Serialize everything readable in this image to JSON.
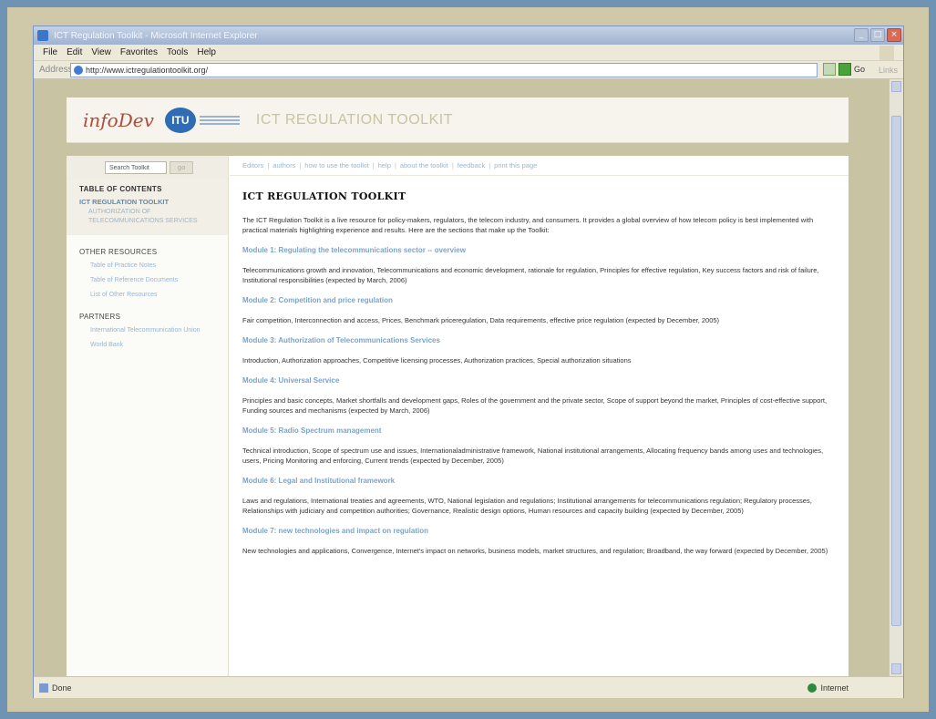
{
  "browser": {
    "window_title": "ICT Regulation Toolkit - Microsoft Internet Explorer",
    "menu": [
      "File",
      "Edit",
      "View",
      "Favorites",
      "Tools",
      "Help"
    ],
    "address_label": "Address",
    "url": "http://www.ictregulationtoolkit.org/",
    "go_label": "Go",
    "links_label": "Links",
    "status_text": "Done",
    "zone_text": "Internet"
  },
  "header": {
    "logo_text": "infoDev",
    "itu_text": "ITU",
    "title": "ICT REGULATION TOOLKIT"
  },
  "sidebar": {
    "search_value": "Search Toolkit",
    "search_button": "go",
    "toc_heading": "TABLE OF CONTENTS",
    "toc_item": "ICT REGULATION TOOLKIT",
    "toc_sub": "AUTHORIZATION OF TELECOMMUNICATIONS SERVICES",
    "other_heading": "OTHER RESOURCES",
    "other_links": [
      "Table of Practice Notes",
      "Table of Reference Documents",
      "List of Other Resources"
    ],
    "partners_heading": "PARTNERS",
    "partner_links": [
      "International Telecommunication Union",
      "World Bank"
    ]
  },
  "content": {
    "toplinks": [
      "Editors",
      "authors",
      "how to use the toolkit",
      "help",
      "about the toolkit",
      "feedback",
      "print this page"
    ],
    "title": "ICT REGULATION TOOLKIT",
    "intro": "The ICT Regulation Toolkit is a live resource for policy-makers, regulators, the telecom industry, and consumers. It provides a global overview of how telecom policy is best implemented with practical materials highlighting experience and results. Here are the sections that make up the Toolkit:",
    "modules": [
      {
        "title": "Module 1: Regulating the telecommunications sector -- overview",
        "desc": "Telecommunications growth and innovation, Telecommunications and economic development, rationale for regulation, Principles for effective regulation, Key success factors and risk of failure, Institutional responsibilities (expected by March, 2006)"
      },
      {
        "title": "Module 2: Competition and price regulation",
        "desc": "Fair competition, Interconnection and access, Prices, Benchmark priceregulation, Data requirements, effective price regulation (expected by December, 2005)"
      },
      {
        "title": "Module 3: Authorization of Telecommunications Services",
        "desc": "Introduction, Authorization approaches, Competitive licensing processes, Authorization practices, Special authorization situations"
      },
      {
        "title": "Module 4: Universal Service",
        "desc": "Principles and basic concepts, Market shortfalls and development gaps, Roles of the government and the private sector, Scope of support beyond the market, Principles of cost-effective support, Funding sources and mechanisms (expected by March, 2006)"
      },
      {
        "title": "Module 5: Radio Spectrum management",
        "desc": "Technical introduction, Scope of spectrum use and issues, Internationaladministrative framework, National institutional arrangements, Allocating frequency bands among uses and technologies, users, Pricing Monitoring and enforcing, Current trends (expected by December, 2005)"
      },
      {
        "title": "Module 6: Legal and Institutional framework",
        "desc": "Laws and regulations, International treaties and agreements, WTO, National legislation and regulations; Institutional arrangements for telecommunications regulation; Regulatory processes, Relationships with judiciary and competition authorities; Governance, Realistic design options, Human resources and capacity building (expected by December, 2005)"
      },
      {
        "title": "Module 7: new technologies and impact on regulation",
        "desc": "New technologies and applications, Convergence, Internet's impact on networks, business models, market structures, and regulation; Broadband, the way forward (expected by December, 2005)"
      }
    ]
  }
}
